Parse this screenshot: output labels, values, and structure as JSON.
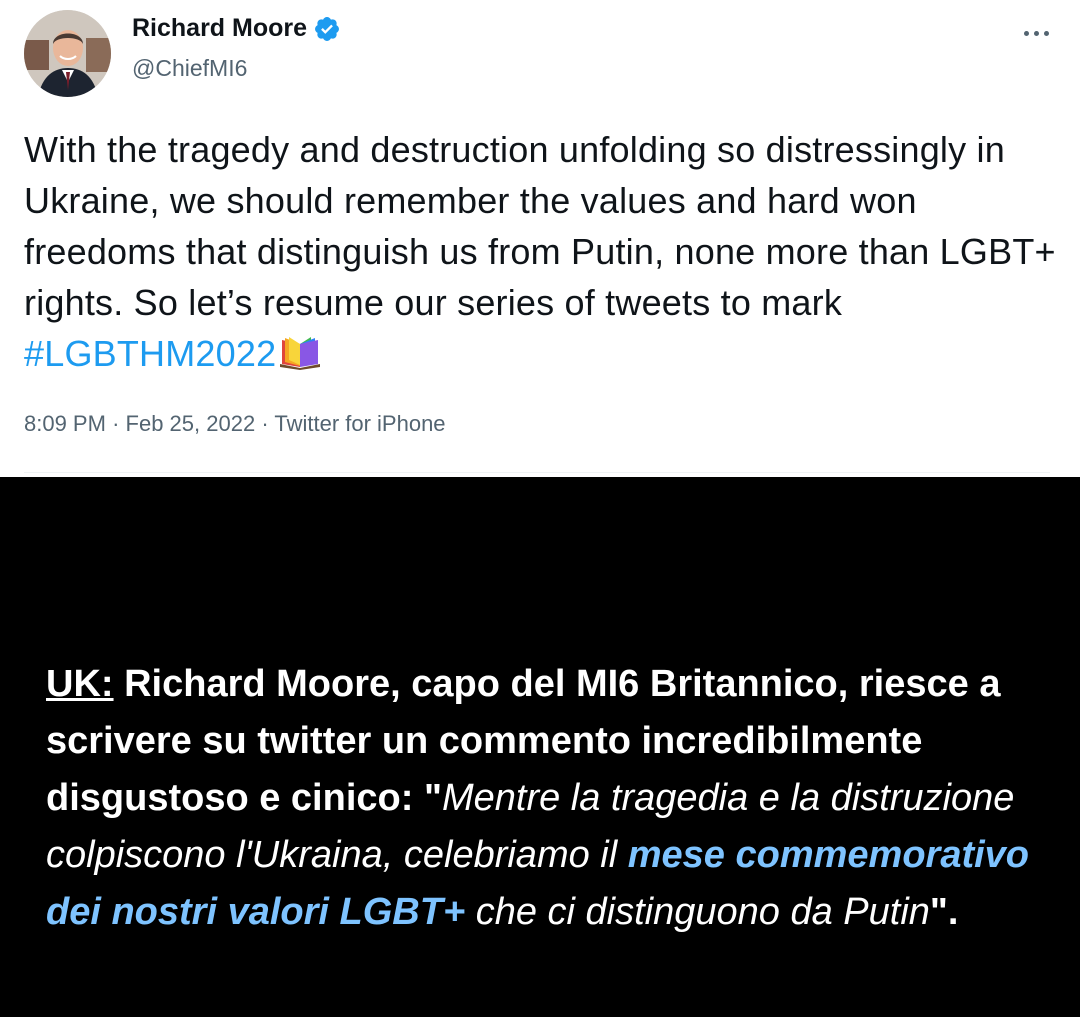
{
  "tweet": {
    "author_name": "Richard Moore",
    "author_handle": "@ChiefMI6",
    "text_before_hashtag": "With the tragedy and destruction unfolding so distressingly in Ukraine, we should remember the values and hard won freedoms that distinguish us from Putin, none more than LGBT+ rights. So let’s resume our series of tweets to mark ",
    "hashtag": "#LGBTHM2022",
    "emoji_icon": "rainbow-book-icon",
    "time": "8:09 PM",
    "separator": "·",
    "date": "Feb 25, 2022",
    "source": "Twitter for iPhone",
    "colors": {
      "hashtag": "#1d9bf0",
      "verified": "#1d9bf0",
      "text": "#0f1419",
      "secondary": "#536471"
    }
  },
  "caption": {
    "label": "UK:",
    "intro": " Richard Moore, capo del MI6 Britannico, riesce a scrivere su twitter un commento incredibilmente disgustoso e cinico: \"",
    "quote_part1": "Mentre la tragedia e la distruzione colpiscono l'Ukraina, celebriamo il ",
    "quote_highlight": "mese commemorativo dei nostri valori LGBT+",
    "quote_part2": " che ci distinguono da Putin",
    "closing": "\".",
    "colors": {
      "background": "#000000",
      "text": "#ffffff",
      "highlight": "#7ec3ff"
    }
  }
}
